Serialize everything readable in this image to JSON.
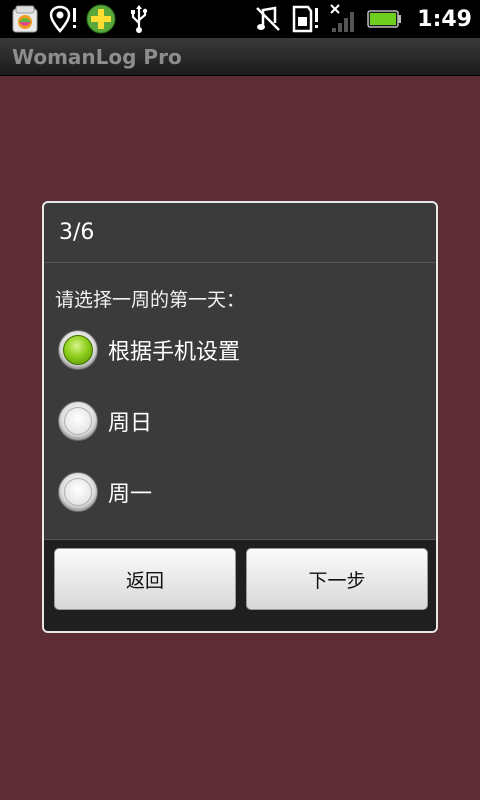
{
  "status_bar": {
    "time": "1:49",
    "battery": "99",
    "icons": [
      "app-store-icon",
      "location-alert-icon",
      "plus-icon",
      "usb-icon",
      "mute-icon",
      "sd-card-alert-icon",
      "no-signal-icon",
      "battery-icon"
    ]
  },
  "app": {
    "title": "WomanLog Pro"
  },
  "dialog": {
    "step": "3/6",
    "prompt": "请选择一周的第一天：",
    "options": [
      {
        "label": "根据手机设置",
        "selected": true
      },
      {
        "label": "周日",
        "selected": false
      },
      {
        "label": "周一",
        "selected": false
      }
    ],
    "back_label": "返回",
    "next_label": "下一步"
  },
  "colors": {
    "background": "#5c2d35",
    "dialog": "#3b3b3b",
    "radio_selected": "#8fcf1c"
  }
}
